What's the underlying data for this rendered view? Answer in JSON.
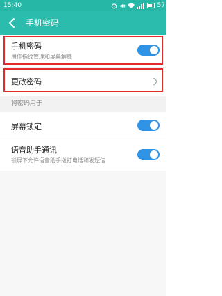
{
  "status_bar": {
    "time": "15:40",
    "battery_text": "57"
  },
  "header": {
    "title": "手机密码"
  },
  "rows": {
    "phone_password": {
      "label": "手机密码",
      "subtitle": "用作指纹管理和屏幕解锁",
      "enabled": true
    },
    "change_password": {
      "label": "更改密码"
    },
    "section": {
      "label": "将密码用于"
    },
    "screen_lock": {
      "label": "屏幕锁定",
      "enabled": true
    },
    "voice_assistant": {
      "label": "语音助手通讯",
      "subtitle": "锁屏下允许语音助手拨打电话和发短信",
      "enabled": true
    }
  },
  "colors": {
    "header": "#2bbcad",
    "status": "#27b7a7",
    "toggle_on": "#2f93e6",
    "highlight": "#e22b2b"
  }
}
